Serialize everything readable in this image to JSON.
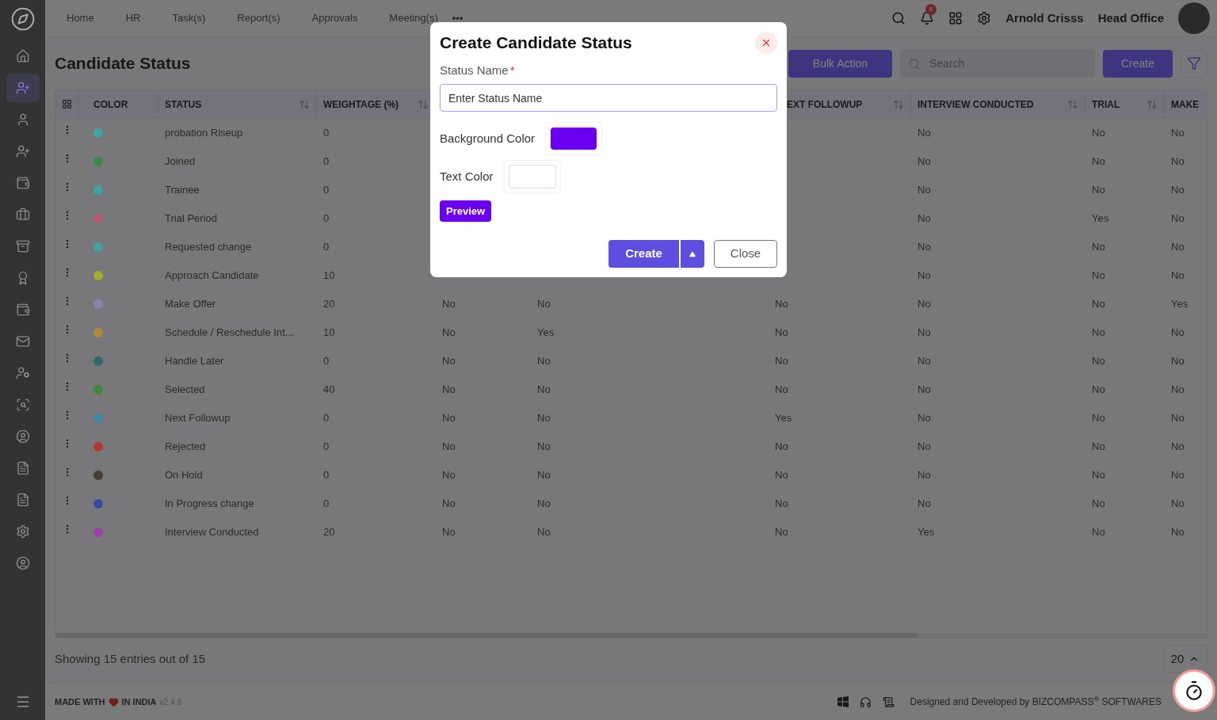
{
  "sidebar": {
    "items": [
      {
        "selected": false
      },
      {
        "selected": true
      },
      {
        "selected": false
      },
      {
        "selected": false
      },
      {
        "selected": false
      },
      {
        "selected": false
      },
      {
        "selected": false
      },
      {
        "selected": false
      },
      {
        "selected": false
      },
      {
        "selected": false
      },
      {
        "selected": false
      },
      {
        "selected": false
      },
      {
        "selected": false
      },
      {
        "selected": false
      },
      {
        "selected": false
      },
      {
        "selected": false
      },
      {
        "selected": false
      }
    ]
  },
  "top_nav": {
    "items": [
      "Home",
      "HR",
      "Task(s)",
      "Report(s)",
      "Approvals",
      "Meeting(s)"
    ],
    "more": "•••"
  },
  "header": {
    "notification_count": "8",
    "user": "Arnold Crisss",
    "office": "Head Office"
  },
  "page": {
    "title": "Candidate Status",
    "bulk_action": "Bulk Action",
    "search": {
      "placeholder": "Search"
    },
    "create": "Create"
  },
  "table": {
    "color_heading": "COLOR",
    "columns": [
      {
        "label": "STATUS",
        "sortable": true
      },
      {
        "label": "WEIGHTAGE (%)",
        "sortable": true
      },
      {},
      {},
      {
        "label": "EXT FOLLOWUP",
        "sortable": true
      },
      {
        "label": "INTERVIEW CONDUCTED",
        "sortable": true
      },
      {
        "label": "TRIAL",
        "sortable": true
      },
      {
        "label": "MAKE"
      }
    ],
    "rows": [
      {
        "color": "#3fa3a6",
        "cells": [
          "probation Riseup",
          "0",
          "",
          "",
          "",
          "No",
          "No",
          "No"
        ]
      },
      {
        "color": "#3a8a48",
        "cells": [
          "Joined",
          "0",
          "",
          "",
          "",
          "No",
          "No",
          "No"
        ]
      },
      {
        "color": "#3fa3a6",
        "cells": [
          "Trainee",
          "0",
          "",
          "",
          "",
          "No",
          "No",
          "No"
        ]
      },
      {
        "color": "#b45c72",
        "cells": [
          "Trial Period",
          "0",
          "",
          "",
          "",
          "No",
          "Yes",
          "No"
        ]
      },
      {
        "color": "#3fa3a6",
        "cells": [
          "Requested change",
          "0",
          "",
          "",
          "",
          "No",
          "No",
          "No"
        ]
      },
      {
        "color": "#a7ab2e",
        "cells": [
          "Approach Candidate",
          "10",
          "",
          "",
          "",
          "No",
          "No",
          "No"
        ]
      },
      {
        "color": "#8a82b0",
        "cells": [
          "Make Offer",
          "20",
          "No",
          "No",
          "No",
          "No",
          "No",
          "Yes"
        ]
      },
      {
        "color": "#b08a3c",
        "cells": [
          "Schedule / Reschedule Int...",
          "10",
          "No",
          "Yes",
          "No",
          "No",
          "No",
          "No"
        ]
      },
      {
        "color": "#2f6b6b",
        "cells": [
          "Handle Later",
          "0",
          "No",
          "No",
          "No",
          "No",
          "No",
          "No"
        ]
      },
      {
        "color": "#3a8a40",
        "cells": [
          "Selected",
          "40",
          "No",
          "No",
          "No",
          "No",
          "No",
          "No"
        ]
      },
      {
        "color": "#3e88a6",
        "cells": [
          "Next Followup",
          "0",
          "No",
          "No",
          "Yes",
          "No",
          "No",
          "No"
        ]
      },
      {
        "color": "#b03a30",
        "cells": [
          "Rejected",
          "0",
          "No",
          "No",
          "No",
          "No",
          "No",
          "No"
        ]
      },
      {
        "color": "#473d33",
        "cells": [
          "On Hold",
          "0",
          "No",
          "No",
          "No",
          "No",
          "No",
          "No"
        ]
      },
      {
        "color": "#3848a8",
        "cells": [
          "In Progress change",
          "0",
          "No",
          "No",
          "No",
          "No",
          "No",
          "No"
        ]
      },
      {
        "color": "#9a44a8",
        "cells": [
          "Interview Conducted",
          "20",
          "No",
          "No",
          "No",
          "Yes",
          "No",
          "No"
        ]
      }
    ]
  },
  "summary": "Showing 15 entries out of 15",
  "page_size": "20",
  "footer": {
    "made_with": "MADE WITH",
    "in_india": "IN INDIA",
    "version": "v2.4.9",
    "credit": "Designed and Developed by",
    "brand": "BIZCOMPASS",
    "brand_mark": "®",
    "company": "SOFTWARES"
  },
  "modal": {
    "title": "Create Candidate Status",
    "status_name_label": "Status Name",
    "required_mark": "*",
    "status_name": {
      "placeholder": "Enter Status Name"
    },
    "background_color_label": "Background Color",
    "text_color_label": "Text Color",
    "preview": "Preview",
    "create": "Create",
    "close": "Close"
  }
}
